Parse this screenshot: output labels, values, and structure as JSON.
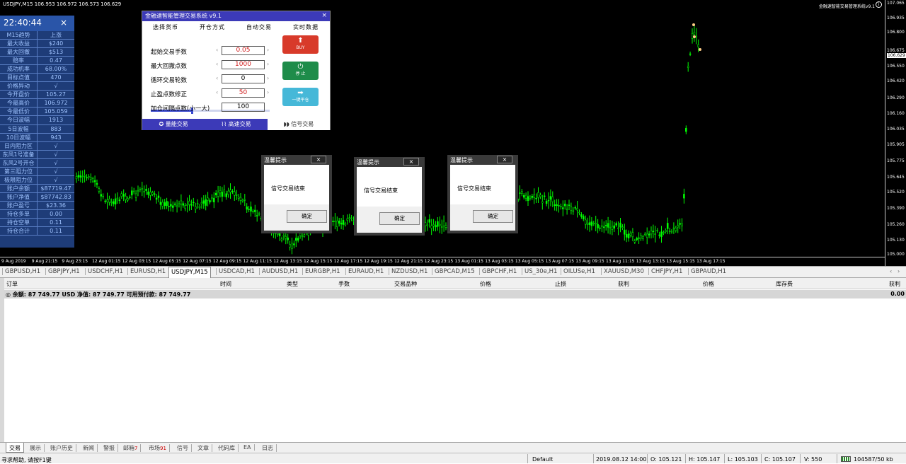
{
  "chart": {
    "symbol_title": "USDJPY,M15  106.953 106.972 106.573 106.629",
    "ea_title": "金融速智能交易管理系统v9.1",
    "info_icon": "info-icon",
    "price_labels": [
      "107.065",
      "106.935",
      "106.800",
      "106.675",
      "106.629",
      "106.550",
      "106.420",
      "106.290",
      "106.160",
      "106.035",
      "105.905",
      "105.775",
      "105.645",
      "105.520",
      "105.390",
      "105.260",
      "105.130",
      "105.000"
    ],
    "current_price": "106.629",
    "time_labels": [
      "9 Aug 2019",
      "9 Aug 21:15",
      "9 Aug 23:15",
      "12 Aug 01:15",
      "12 Aug 03:15",
      "12 Aug 05:15",
      "12 Aug 07:15",
      "12 Aug 09:15",
      "12 Aug 11:15",
      "12 Aug 13:15",
      "12 Aug 15:15",
      "12 Aug 17:15",
      "12 Aug 19:15",
      "12 Aug 21:15",
      "12 Aug 23:15",
      "13 Aug 01:15",
      "13 Aug 03:15",
      "13 Aug 05:15",
      "13 Aug 07:15",
      "13 Aug 09:15",
      "13 Aug 11:15",
      "13 Aug 13:15",
      "13 Aug 15:15",
      "13 Aug 17:15"
    ],
    "candle_color": "#00ff00"
  },
  "stats": {
    "clock": "22:40:44",
    "close": "×",
    "rows": [
      {
        "k": "M15趋势",
        "v": "上涨"
      },
      {
        "k": "最大收益",
        "v": "$240"
      },
      {
        "k": "最大回撤",
        "v": "$513"
      },
      {
        "k": "赔率",
        "v": "0.47"
      },
      {
        "k": "成功机率",
        "v": "68.00%"
      },
      {
        "k": "目标点值",
        "v": "470"
      },
      {
        "k": "价格异动",
        "v": "√"
      },
      {
        "k": "今开盘价",
        "v": "105.27"
      },
      {
        "k": "今最高价",
        "v": "106.972"
      },
      {
        "k": "今最低价",
        "v": "105.059"
      },
      {
        "k": "今日波幅",
        "v": "1913"
      },
      {
        "k": "5日波幅",
        "v": "883"
      },
      {
        "k": "10日波幅",
        "v": "943"
      },
      {
        "k": "日内阻力区",
        "v": "√"
      },
      {
        "k": "东风1号准备",
        "v": "√"
      },
      {
        "k": "东风2号开仓",
        "v": "√"
      },
      {
        "k": "第三阻力位",
        "v": "√"
      },
      {
        "k": "极限阻力位",
        "v": "√"
      },
      {
        "k": "账户余额",
        "v": "$87719.47"
      },
      {
        "k": "账户净值",
        "v": "$87742.83"
      },
      {
        "k": "账户盈亏",
        "v": "$23.36"
      },
      {
        "k": "持仓多单",
        "v": "0.00"
      },
      {
        "k": "持仓空单",
        "v": "0.11"
      },
      {
        "k": "持仓合计",
        "v": "0.11"
      }
    ]
  },
  "panel": {
    "title": "金融速智能管理交易系统 v9.1",
    "close": "×",
    "headers": [
      "选择货币",
      "开仓方式",
      "自动交易",
      "实时数据"
    ],
    "rows": [
      {
        "label": "起始交易手数",
        "value": "0.05"
      },
      {
        "label": "最大回撤点数",
        "value": "1000"
      },
      {
        "label": "循环交易轮数",
        "value": "0"
      },
      {
        "label": "止盈点数修正",
        "value": "50"
      },
      {
        "label": "加仓间隔点数(小一大)",
        "value": "100"
      }
    ],
    "arrow_left": "‹",
    "arrow_right": "›",
    "slider_value": 0.35,
    "buttons": [
      {
        "label": "BUY",
        "symbol": "⬆",
        "color": "#d83a2a"
      },
      {
        "label": "停 止",
        "symbol": "⏻",
        "color": "#1e8c4a"
      },
      {
        "label": "一键平仓",
        "symbol": "➡",
        "color": "#46b8d8"
      }
    ],
    "tabs": [
      "✪  量能交易",
      "⌇⌇  高速交易",
      "◗◗  信号交易"
    ]
  },
  "dialogs": [
    {
      "title": "温馨提示",
      "message": "信号交易结束",
      "ok": "确定",
      "close": "×"
    },
    {
      "title": "温馨提示",
      "message": "信号交易结束",
      "ok": "确定",
      "close": "×"
    },
    {
      "title": "温馨提示",
      "message": "信号交易结束",
      "ok": "确定",
      "close": "×"
    }
  ],
  "symbol_tabs": [
    "GBPUSD,H1",
    "GBPJPY,H1",
    "USDCHF,H1",
    "EURUSD,H1",
    "USDJPY,M15",
    "USDCAD,H1",
    "AUDUSD,H1",
    "EURGBP,H1",
    "EURAUD,H1",
    "NZDUSD,H1",
    "GBPCAD,M15",
    "GBPCHF,H1",
    "US_30e,H1",
    "OILUSe,H1",
    "XAUUSD,M30",
    "CHFJPY,H1",
    "GBPAUD,H1"
  ],
  "symbol_tabs_active": 4,
  "symbol_arrows": [
    "‹",
    "›"
  ],
  "terminal": {
    "columns": [
      "订单",
      "时间",
      "类型",
      "手数",
      "交易品种",
      "价格",
      "止损",
      "获利",
      "价格",
      "库存费",
      "获利"
    ],
    "balance_line": "◎  余额: 87 749.77 USD  净值: 87 749.77  可用预付款: 87 749.77",
    "balance_profit": "0.00"
  },
  "bottom_tabs": [
    {
      "label": "交易",
      "badge": ""
    },
    {
      "label": "展示",
      "badge": ""
    },
    {
      "label": "账户历史",
      "badge": ""
    },
    {
      "label": "新闻",
      "badge": ""
    },
    {
      "label": "警报",
      "badge": ""
    },
    {
      "label": "邮箱",
      "badge": "7"
    },
    {
      "label": "市场",
      "badge": "91"
    },
    {
      "label": "信号",
      "badge": ""
    },
    {
      "label": "文章",
      "badge": ""
    },
    {
      "label": "代码库",
      "badge": ""
    },
    {
      "label": "EA",
      "badge": ""
    },
    {
      "label": "日志",
      "badge": ""
    }
  ],
  "status": {
    "help": "寻求帮助, 请按F1键",
    "profile": "Default",
    "datetime": "2019.08.12 14:00",
    "open": "O: 105.121",
    "high": "H: 105.147",
    "low": "L: 105.103",
    "close": "C: 105.107",
    "volume": "V: 550",
    "traffic": "104587/50 kb"
  }
}
